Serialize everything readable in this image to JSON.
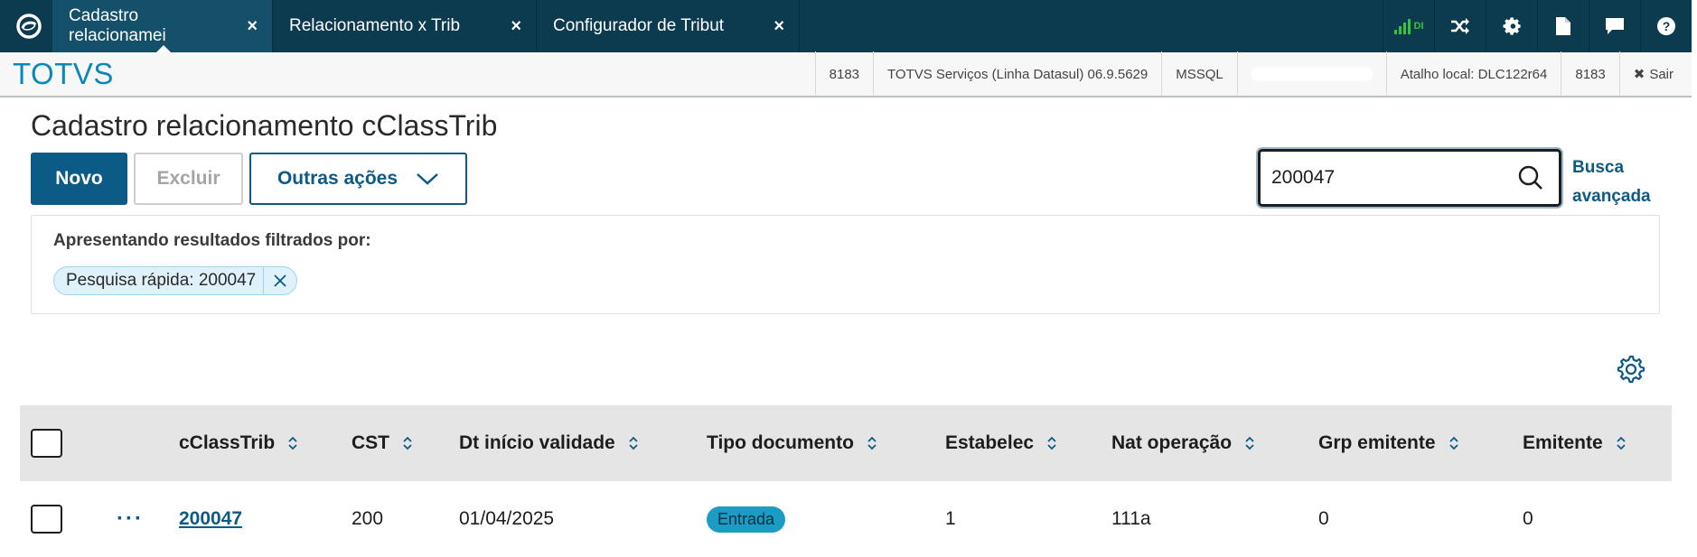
{
  "topbar": {
    "tabs": [
      {
        "label": "Cadastro relacionamei",
        "close": "×"
      },
      {
        "label": "Relacionamento x Trib",
        "close": "×"
      },
      {
        "label": "Configurador de Tribut",
        "close": "×"
      }
    ],
    "signal_label": "DI",
    "icons": [
      "shuffle-icon",
      "gear-icon",
      "document-icon",
      "chat-icon",
      "help-icon"
    ]
  },
  "brandbar": {
    "brand": "TOTVS",
    "info": [
      "8183",
      "TOTVS Serviços (Linha Datasul) 06.9.5629",
      "MSSQL",
      "Atalho local: DLC122r64",
      "8183"
    ],
    "exit_label": "Sair"
  },
  "page": {
    "title": "Cadastro relacionamento cClassTrib",
    "actions": {
      "new": "Novo",
      "delete": "Excluir",
      "more": "Outras ações"
    },
    "search": {
      "value": "200047",
      "placeholder": ""
    },
    "advanced_search": "Busca avançada"
  },
  "filters": {
    "title": "Apresentando resultados filtrados por:",
    "chips": [
      {
        "label": "Pesquisa rápida: 200047"
      }
    ]
  },
  "table": {
    "columns": [
      "cClassTrib",
      "CST",
      "Dt início validade",
      "Tipo documento",
      "Estabelec",
      "Nat operação",
      "Grp emitente",
      "Emitente"
    ],
    "rows": [
      {
        "actions": "···",
        "cclasstrib": "200047",
        "cst": "200",
        "dt_inicio": "01/04/2025",
        "tipo_documento": "Entrada",
        "estabelec": "1",
        "nat_operacao": "111a",
        "grp_emitente": "0",
        "emitente": "0"
      }
    ]
  },
  "colors": {
    "topbar": "#0c3a4e",
    "primary": "#0c5a86",
    "brand": "#0a89b8",
    "badge": "#1a9cc4",
    "signal": "#39c23d"
  }
}
